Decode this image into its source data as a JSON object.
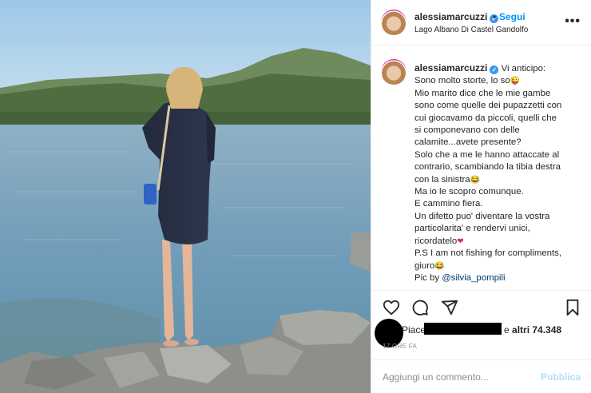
{
  "post": {
    "username": "alessiamarcuzzi",
    "verified_mark": "✓",
    "follow_label": "Segui",
    "separator": "•",
    "location": "Lago Albano Di Castel Gandolfo",
    "more_icon": "more-horizontal-icon",
    "more_glyph": "•••"
  },
  "caption": {
    "lines": [
      "Vi anticipo:",
      "Sono molto storte, lo so",
      "Mio marito dice che le mie gambe",
      "sono come quelle dei pupazzetti con",
      "cui giocavamo da piccoli, quelli che",
      "si componevano con delle",
      "calamite...avete presente?",
      "Solo che a me le hanno attaccate al",
      "contrario, scambiando la tibia destra",
      "con la sinistra",
      "Ma io le scopro comunque.",
      "E cammino fiera.",
      "Un difetto puo' diventare la vostra",
      "particolarita' e rendervi unici,",
      "ricordatelo",
      "P.S I am not fishing for compliments,",
      "giuro",
      "Pic by"
    ],
    "mention": "@silvia_pompili",
    "emoji_wink": "😜",
    "emoji_laugh": "😂",
    "emoji_heart": "❤"
  },
  "actions": {
    "icons": [
      "heart-icon",
      "comment-icon",
      "share-icon",
      "bookmark-icon"
    ]
  },
  "likes": {
    "prefix": "Piace",
    "middle": "e",
    "count_text": "altri 74.348"
  },
  "time": "17 ORE FA",
  "comment": {
    "placeholder": "Aggiungi un commento...",
    "publish_label": "Pubblica"
  },
  "colors": {
    "accent": "#0095f6",
    "verified": "#3897f0",
    "publish_disabled": "#b2dffc",
    "muted": "#8e8e8e",
    "mention": "#00376b"
  }
}
